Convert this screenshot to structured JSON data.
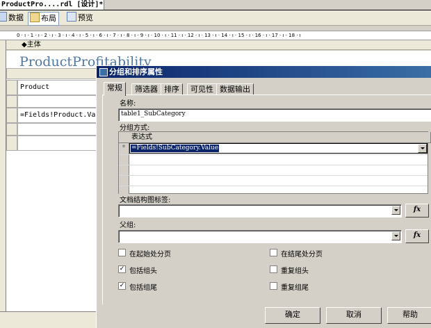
{
  "document_tab": {
    "title": "ProductPro....rdl [设计]*"
  },
  "view_tabs": [
    {
      "label": "数据"
    },
    {
      "label": "布局"
    },
    {
      "label": "预览"
    }
  ],
  "ruler": {
    "text": "0 · ı · 1 · ı · 2 · ı · 3 · ı · 4 · ı · 5 · ı · 6 · ı · 7 · ı · 8 · ı · 9 · ı · 10 · ı · 11 · ı · 12 · ı · 13 · ı · 14 · ı · 15 · ı · 16 · ı · 17 · ı · 18 · ı"
  },
  "body_section": {
    "label": "◆主体"
  },
  "report": {
    "title": "ProductProfitability",
    "cells": [
      "Product",
      "",
      "=Fields!Product.Val",
      "",
      ""
    ]
  },
  "dialog": {
    "title": "分组和排序属性",
    "tabs": [
      {
        "label": "常规"
      },
      {
        "label": "筛选器"
      },
      {
        "label": "排序"
      },
      {
        "label": "可见性"
      },
      {
        "label": "数据输出"
      }
    ],
    "name_label": "名称:",
    "name_value": "table1_SubCategory",
    "group_by_label": "分组方式:",
    "grid": {
      "header": "表达式",
      "row_marker": "*",
      "expression": "=Fields!SubCategory.Value"
    },
    "doc_map_label": "文档结构图标签:",
    "doc_map_value": "",
    "parent_label": "父组:",
    "parent_value": "",
    "fx_label": "fx",
    "checkboxes": [
      {
        "label": "在起始处分页",
        "checked": false
      },
      {
        "label": "在结尾处分页",
        "checked": false
      },
      {
        "label": "包括组头",
        "checked": true
      },
      {
        "label": "重复组头",
        "checked": false
      },
      {
        "label": "包括组尾",
        "checked": true
      },
      {
        "label": "重复组尾",
        "checked": false
      }
    ],
    "buttons": {
      "ok": "确定",
      "cancel": "取消",
      "help": "帮助"
    }
  },
  "colors": {
    "title_bar": "#0a246a",
    "selection": "#0a246a",
    "report_title": "#5078a0"
  }
}
